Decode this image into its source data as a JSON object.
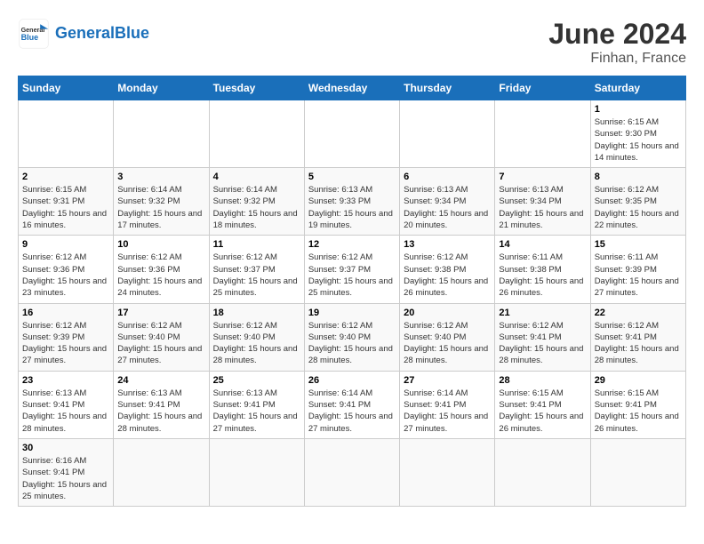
{
  "header": {
    "logo_general": "General",
    "logo_blue": "Blue",
    "month": "June 2024",
    "location": "Finhan, France"
  },
  "days_of_week": [
    "Sunday",
    "Monday",
    "Tuesday",
    "Wednesday",
    "Thursday",
    "Friday",
    "Saturday"
  ],
  "weeks": [
    [
      null,
      null,
      null,
      null,
      null,
      null,
      {
        "day": "1",
        "sunrise": "6:15 AM",
        "sunset": "9:30 PM",
        "daylight": "15 hours and 14 minutes."
      }
    ],
    [
      {
        "day": "2",
        "sunrise": "6:15 AM",
        "sunset": "9:31 PM",
        "daylight": "15 hours and 16 minutes."
      },
      {
        "day": "3",
        "sunrise": "6:14 AM",
        "sunset": "9:32 PM",
        "daylight": "15 hours and 17 minutes."
      },
      {
        "day": "4",
        "sunrise": "6:14 AM",
        "sunset": "9:32 PM",
        "daylight": "15 hours and 18 minutes."
      },
      {
        "day": "5",
        "sunrise": "6:13 AM",
        "sunset": "9:33 PM",
        "daylight": "15 hours and 19 minutes."
      },
      {
        "day": "6",
        "sunrise": "6:13 AM",
        "sunset": "9:34 PM",
        "daylight": "15 hours and 20 minutes."
      },
      {
        "day": "7",
        "sunrise": "6:13 AM",
        "sunset": "9:34 PM",
        "daylight": "15 hours and 21 minutes."
      },
      {
        "day": "8",
        "sunrise": "6:12 AM",
        "sunset": "9:35 PM",
        "daylight": "15 hours and 22 minutes."
      }
    ],
    [
      {
        "day": "9",
        "sunrise": "6:12 AM",
        "sunset": "9:36 PM",
        "daylight": "15 hours and 23 minutes."
      },
      {
        "day": "10",
        "sunrise": "6:12 AM",
        "sunset": "9:36 PM",
        "daylight": "15 hours and 24 minutes."
      },
      {
        "day": "11",
        "sunrise": "6:12 AM",
        "sunset": "9:37 PM",
        "daylight": "15 hours and 25 minutes."
      },
      {
        "day": "12",
        "sunrise": "6:12 AM",
        "sunset": "9:37 PM",
        "daylight": "15 hours and 25 minutes."
      },
      {
        "day": "13",
        "sunrise": "6:12 AM",
        "sunset": "9:38 PM",
        "daylight": "15 hours and 26 minutes."
      },
      {
        "day": "14",
        "sunrise": "6:11 AM",
        "sunset": "9:38 PM",
        "daylight": "15 hours and 26 minutes."
      },
      {
        "day": "15",
        "sunrise": "6:11 AM",
        "sunset": "9:39 PM",
        "daylight": "15 hours and 27 minutes."
      }
    ],
    [
      {
        "day": "16",
        "sunrise": "6:12 AM",
        "sunset": "9:39 PM",
        "daylight": "15 hours and 27 minutes."
      },
      {
        "day": "17",
        "sunrise": "6:12 AM",
        "sunset": "9:40 PM",
        "daylight": "15 hours and 27 minutes."
      },
      {
        "day": "18",
        "sunrise": "6:12 AM",
        "sunset": "9:40 PM",
        "daylight": "15 hours and 28 minutes."
      },
      {
        "day": "19",
        "sunrise": "6:12 AM",
        "sunset": "9:40 PM",
        "daylight": "15 hours and 28 minutes."
      },
      {
        "day": "20",
        "sunrise": "6:12 AM",
        "sunset": "9:40 PM",
        "daylight": "15 hours and 28 minutes."
      },
      {
        "day": "21",
        "sunrise": "6:12 AM",
        "sunset": "9:41 PM",
        "daylight": "15 hours and 28 minutes."
      },
      {
        "day": "22",
        "sunrise": "6:12 AM",
        "sunset": "9:41 PM",
        "daylight": "15 hours and 28 minutes."
      }
    ],
    [
      {
        "day": "23",
        "sunrise": "6:13 AM",
        "sunset": "9:41 PM",
        "daylight": "15 hours and 28 minutes."
      },
      {
        "day": "24",
        "sunrise": "6:13 AM",
        "sunset": "9:41 PM",
        "daylight": "15 hours and 28 minutes."
      },
      {
        "day": "25",
        "sunrise": "6:13 AM",
        "sunset": "9:41 PM",
        "daylight": "15 hours and 27 minutes."
      },
      {
        "day": "26",
        "sunrise": "6:14 AM",
        "sunset": "9:41 PM",
        "daylight": "15 hours and 27 minutes."
      },
      {
        "day": "27",
        "sunrise": "6:14 AM",
        "sunset": "9:41 PM",
        "daylight": "15 hours and 27 minutes."
      },
      {
        "day": "28",
        "sunrise": "6:15 AM",
        "sunset": "9:41 PM",
        "daylight": "15 hours and 26 minutes."
      },
      {
        "day": "29",
        "sunrise": "6:15 AM",
        "sunset": "9:41 PM",
        "daylight": "15 hours and 26 minutes."
      }
    ],
    [
      {
        "day": "30",
        "sunrise": "6:16 AM",
        "sunset": "9:41 PM",
        "daylight": "15 hours and 25 minutes."
      },
      null,
      null,
      null,
      null,
      null,
      null
    ]
  ]
}
